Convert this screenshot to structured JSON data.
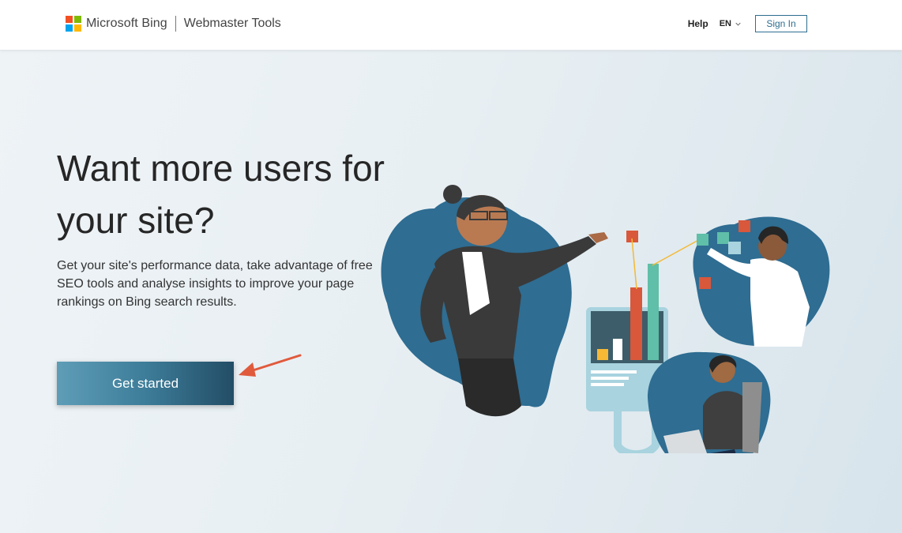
{
  "header": {
    "brand_name": "Microsoft Bing",
    "product_name": "Webmaster Tools",
    "logo_colors": [
      "#f25022",
      "#7fba00",
      "#00a4ef",
      "#ffb900"
    ],
    "help_label": "Help",
    "language": "EN",
    "signin_label": "Sign In"
  },
  "hero": {
    "headline": "Want more users for your site?",
    "subtext": "Get your site's performance data, take advantage of free SEO tools and analyse insights to improve your page rankings on Bing search results.",
    "cta_label": "Get started"
  },
  "colors": {
    "accent": "#2e6e8e",
    "cta_gradient_start": "#5f9db7",
    "cta_gradient_end": "#234d66",
    "arrow": "#e05a3c",
    "blob": "#2f6d92"
  }
}
